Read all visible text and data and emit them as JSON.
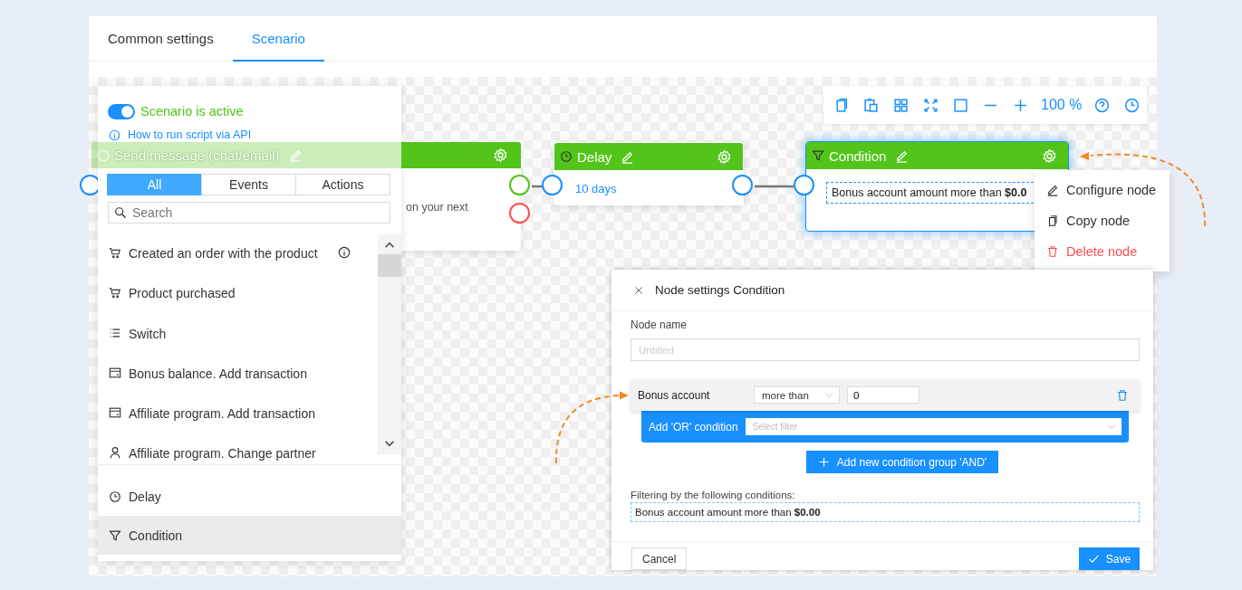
{
  "tabs": [
    {
      "label": "Common settings",
      "selected": false
    },
    {
      "label": "Scenario",
      "selected": true
    }
  ],
  "panel": {
    "active": true,
    "status": "Scenario is active",
    "help_link": "How to run script via API",
    "filters": [
      {
        "label": "All",
        "selected": true
      },
      {
        "label": "Events",
        "selected": false
      },
      {
        "label": "Actions",
        "selected": false
      }
    ],
    "search": {
      "placeholder": "Search"
    },
    "items": [
      {
        "kind": "order",
        "label": "Created an order with the product",
        "info": true
      },
      {
        "kind": "cart",
        "label": "Product purchased",
        "info": false
      },
      {
        "kind": "switch",
        "label": "Switch",
        "info": false
      },
      {
        "kind": "card",
        "label": "Bonus balance. Add transaction",
        "info": false
      },
      {
        "kind": "card",
        "label": "Affiliate program. Add transaction",
        "info": false
      },
      {
        "kind": "user",
        "label": "Affiliate program. Change partner",
        "info": false
      }
    ],
    "pinned": [
      {
        "kind": "clock",
        "label": "Delay",
        "selected": false
      },
      {
        "kind": "filter",
        "label": "Condition",
        "selected": true
      }
    ]
  },
  "nodes": [
    {
      "kind": "send",
      "title": "Send message (chat/email)",
      "body": "on your next",
      "selected": false
    },
    {
      "kind": "delay",
      "title": "Delay",
      "body": "10 days",
      "selected": false
    },
    {
      "kind": "condition",
      "title": "Condition",
      "body": "Bonus account amount more than **$0.0**",
      "selected": true
    }
  ],
  "toolbar": {
    "zoom": "100 %"
  },
  "context_menu": [
    {
      "kind": "edit",
      "label": "Configure node"
    },
    {
      "kind": "copy",
      "label": "Copy node"
    },
    {
      "kind": "delete",
      "label": "Delete node"
    }
  ],
  "dialog": {
    "title": "Node settings Condition",
    "name_label": "Node name",
    "name_placeholder": "Untitled",
    "condition": {
      "field": "Bonus account",
      "operator": "more than",
      "value": "0"
    },
    "or_label": "Add 'OR' condition",
    "or_placeholder": "Select filter",
    "and_button": "Add new condition group 'AND'",
    "summary_label": "Filtering by the following conditions:",
    "summary": "Bonus account amount more than **$0.00**",
    "cancel": "Cancel",
    "save": "Save"
  }
}
